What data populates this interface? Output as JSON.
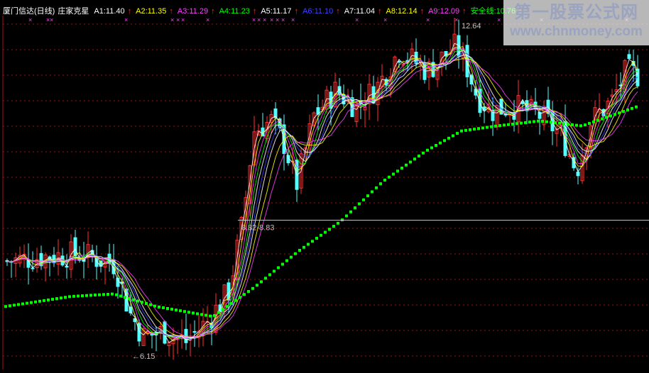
{
  "header": {
    "title": "厦门信达(日线)",
    "indicator": "庄家克星",
    "averages": [
      {
        "label": "A1:11.40",
        "color": "#ffffff"
      },
      {
        "label": "A2:11.35",
        "color": "#ffff00"
      },
      {
        "label": "A3:11.29",
        "color": "#ff40ff"
      },
      {
        "label": "A4:11.23",
        "color": "#00ff00"
      },
      {
        "label": "A5:11.17",
        "color": "#ffffff"
      },
      {
        "label": "A6:11.10",
        "color": "#4040ff"
      },
      {
        "label": "A7:11.04",
        "color": "#ffffff"
      },
      {
        "label": "A8:12.14",
        "color": "#ffff00"
      },
      {
        "label": "A9:12.09",
        "color": "#ff40ff"
      },
      {
        "label": "安全线:10.76",
        "color": "#00ff00"
      }
    ],
    "arrow_glyph": "↑",
    "arrow_color": "#ff3030"
  },
  "annotations": {
    "high_label": "12.64",
    "low_label": "6.15",
    "range_label": "8.82-8.83",
    "marker_glyph": "×"
  },
  "watermark": {
    "title": "第一股票公式网",
    "url": "www.chnmoney.com"
  },
  "colors": {
    "up": "#ff3030",
    "down": "#54ffff",
    "safety_line": "#00ff00",
    "grid": "#a01010",
    "axis": "#a01010"
  },
  "chart_data": {
    "type": "candlestick",
    "y_range": [
      6.0,
      12.9
    ],
    "safety_line_last": 10.76,
    "high": 12.64,
    "low": 6.15,
    "support": 8.82
  }
}
